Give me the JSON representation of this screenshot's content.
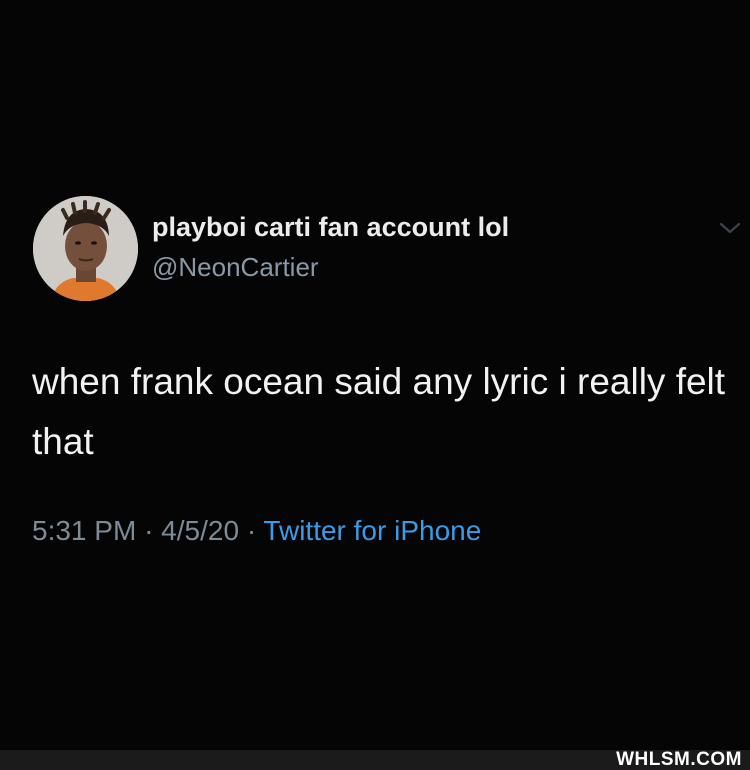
{
  "tweet": {
    "display_name": "playboi carti fan account lol",
    "handle": "@NeonCartier",
    "text": "when frank ocean said any lyric i really felt that",
    "time": "5:31 PM",
    "separator_1": "·",
    "date": "4/5/20",
    "separator_2": "·",
    "source": "Twitter for iPhone"
  },
  "icons": {
    "avatar": "profile-photo",
    "chevron": "chevron-down-icon"
  },
  "colors": {
    "background": "#000000",
    "name": "#ececec",
    "handle": "#8b98a5",
    "text": "#f2f2f2",
    "meta": "#7e8a96",
    "link": "#3b9be6"
  },
  "watermark": {
    "text": "WHLSM.COM"
  }
}
